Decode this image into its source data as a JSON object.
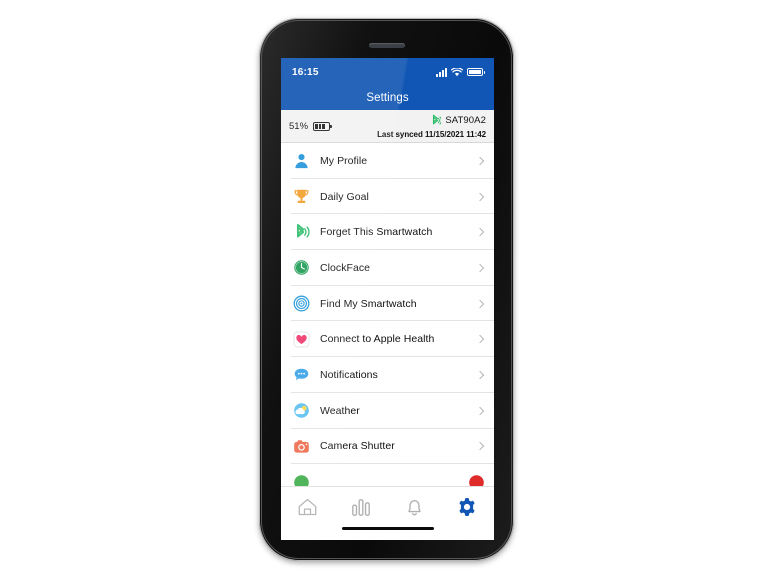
{
  "device_frame": {
    "name": "smartphone-mockup"
  },
  "status_bar": {
    "time": "16:15",
    "signal_icon": "cellular-signal-icon",
    "wifi_icon": "wifi-icon",
    "battery_icon": "battery-full-icon"
  },
  "nav": {
    "title": "Settings"
  },
  "device_info": {
    "battery_percent": "51%",
    "battery_icon": "battery-half-icon",
    "bluetooth_icon": "bluetooth-connected-icon",
    "watch_name": "SAT90A2",
    "last_synced": "Last synced 11/15/2021 11:42"
  },
  "settings_rows": [
    {
      "label": "My Profile",
      "icon": "person-icon",
      "color": "#2196d9",
      "chevron": "chevron-right-icon"
    },
    {
      "label": "Daily Goal",
      "icon": "trophy-icon",
      "color": "#f2a02c",
      "chevron": "chevron-right-icon"
    },
    {
      "label": "Forget This Smartwatch",
      "icon": "bluetooth-icon",
      "color": "#2ebd6b",
      "chevron": "chevron-right-icon"
    },
    {
      "label": "ClockFace",
      "icon": "clock-face-icon",
      "color": "#1f9d55",
      "chevron": "chevron-right-icon"
    },
    {
      "label": "Find My Smartwatch",
      "icon": "find-target-icon",
      "color": "#2196d9",
      "chevron": "chevron-right-icon"
    },
    {
      "label": "Connect to Apple Health",
      "icon": "apple-health-heart-icon",
      "color": "#f0386b",
      "chevron": "chevron-right-icon"
    },
    {
      "label": "Notifications",
      "icon": "chat-bubble-icon",
      "color": "#3aa3e8",
      "chevron": "chevron-right-icon"
    },
    {
      "label": "Weather",
      "icon": "weather-cloud-sun-icon",
      "color": "#5bc0f0",
      "chevron": "chevron-right-icon"
    },
    {
      "label": "Camera Shutter",
      "icon": "camera-icon",
      "color": "#ef6c4d",
      "chevron": "chevron-right-icon"
    }
  ],
  "partial_row": {
    "left_icon": "green-partial-icon",
    "left_color": "#3fae4a",
    "right_icon": "red-partial-icon",
    "right_color": "#e02b2b"
  },
  "tab_bar": {
    "tabs": [
      {
        "name": "home",
        "icon": "home-icon",
        "active": false
      },
      {
        "name": "activity",
        "icon": "bar-chart-icon",
        "active": false
      },
      {
        "name": "notifications",
        "icon": "bell-icon",
        "active": false
      },
      {
        "name": "settings",
        "icon": "gear-icon",
        "active": true
      }
    ],
    "active_color": "#1156b4",
    "inactive_color": "#b0b0b0"
  },
  "colors": {
    "header_blue": "#1156b4",
    "screen_bg": "#ffffff",
    "info_strip_bg": "#f2f2f2",
    "separator": "#e3e3e3"
  }
}
